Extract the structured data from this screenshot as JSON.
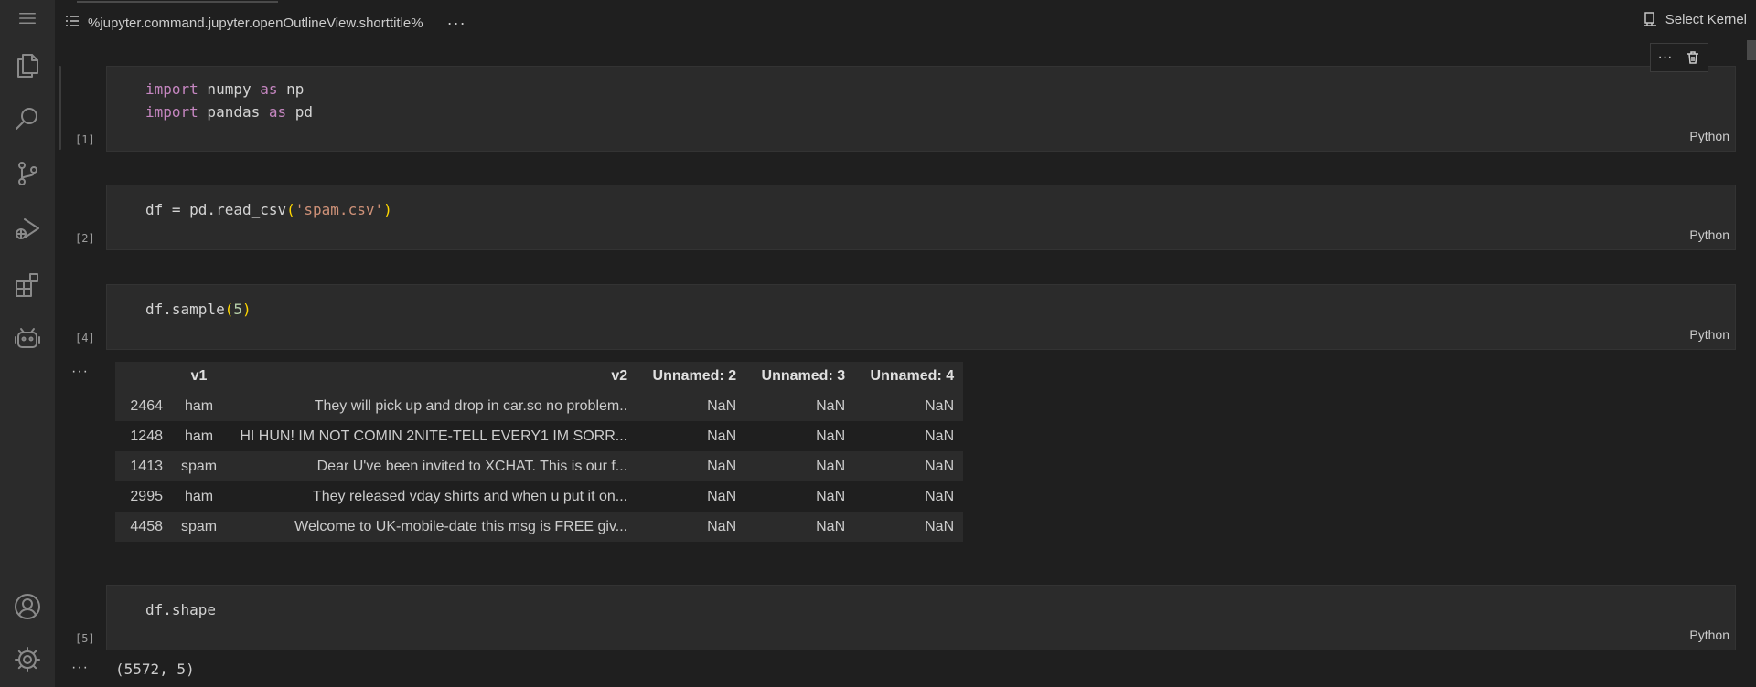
{
  "toolbar": {
    "outline_label": "%jupyter.command.jupyter.openOutlineView.shorttitle%",
    "more_label": "···",
    "kernel_label": "Select Kernel"
  },
  "cell_toolbar": {
    "more_label": "···"
  },
  "cells": [
    {
      "exec": "[1]",
      "language": "Python"
    },
    {
      "exec": "[2]",
      "language": "Python"
    },
    {
      "exec": "[4]",
      "language": "Python"
    },
    {
      "exec": "[5]",
      "language": "Python"
    }
  ],
  "code": {
    "cell1_line1": {
      "kw1": "import",
      "mod": " numpy ",
      "kw2": "as",
      "alias": " np"
    },
    "cell1_line2": {
      "kw1": "import",
      "mod": " pandas ",
      "kw2": "as",
      "alias": " pd"
    },
    "cell2": {
      "pre": "df = pd.read_csv",
      "open": "(",
      "str": "'spam.csv'",
      "close": ")"
    },
    "cell3": {
      "pre": "df.sample",
      "open": "(",
      "num": "5",
      "close": ")"
    },
    "cell4": "df.shape"
  },
  "outputs": {
    "more_label": "···",
    "table": {
      "columns": [
        "",
        "v1",
        "v2",
        "Unnamed: 2",
        "Unnamed: 3",
        "Unnamed: 4"
      ],
      "rows": [
        [
          "2464",
          "ham",
          "They will pick up and drop in car.so no problem..",
          "NaN",
          "NaN",
          "NaN"
        ],
        [
          "1248",
          "ham",
          "HI HUN! IM NOT COMIN 2NITE-TELL EVERY1 IM SORR...",
          "NaN",
          "NaN",
          "NaN"
        ],
        [
          "1413",
          "spam",
          "Dear U've been invited to XCHAT. This is our f...",
          "NaN",
          "NaN",
          "NaN"
        ],
        [
          "2995",
          "ham",
          "They released vday shirts and when u put it on...",
          "NaN",
          "NaN",
          "NaN"
        ],
        [
          "4458",
          "spam",
          "Welcome to UK-mobile-date this msg is FREE giv...",
          "NaN",
          "NaN",
          "NaN"
        ]
      ]
    },
    "shape": "(5572, 5)"
  }
}
